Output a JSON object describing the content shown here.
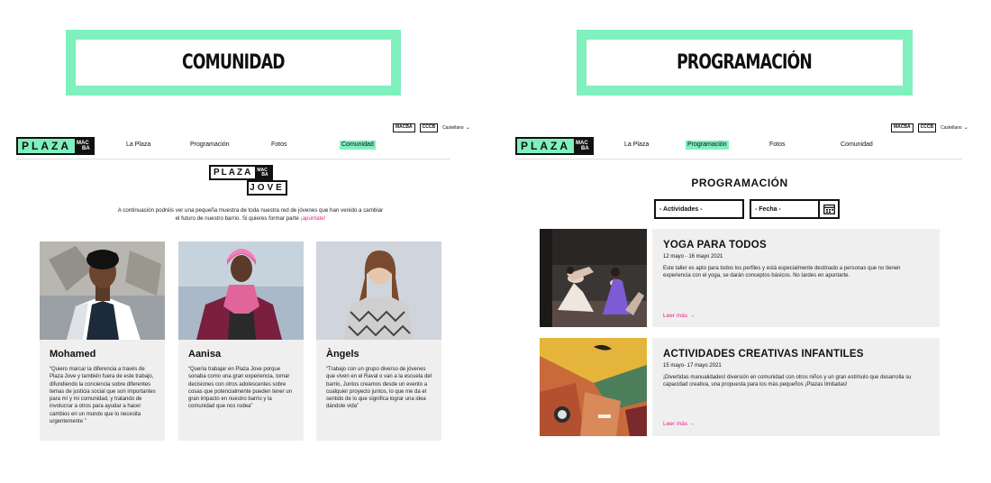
{
  "section_titles": {
    "left": "COMUNIDAD",
    "right": "PROGRAMACIÓN"
  },
  "util": {
    "badges": [
      "MACBA",
      "CCCB"
    ],
    "language": "Castellano"
  },
  "logo": {
    "plaza": "PLAZA",
    "mac": "MAC",
    "ba": "BA"
  },
  "nav": {
    "items": [
      "La Plaza",
      "Programación",
      "Fotos",
      "Comunidad"
    ],
    "active_left": "Comunidad",
    "active_right": "Programación"
  },
  "comunidad": {
    "jove_logo": {
      "plaza": "PLAZA",
      "mac": "MAC",
      "ba": "BA",
      "jove": "JOVE"
    },
    "intro_text": "A continuación podréis ver una pequeña muestra de toda nuestra red de jóvenes que han venido a cambiar el futuro de nuestro barrio. Si quieres formar parte ",
    "intro_link": "¡apúntate!",
    "cards": [
      {
        "name": "Mohamed",
        "quote": "“Quiero marcar la diferencia a través de Plaza Jove y también fuera de este trabajo, difundiendo la conciencia sobre diferentes temas de justicia social que son importantes para mí y mi comunidad, y tratando de involucrar a otros para ayudar a hacer cambios en un mundo que lo necesita urgentemente ”"
      },
      {
        "name": "Aanisa",
        "quote": "“Quería trabajar en Plaza Jove porque sonaba como una gran experiencia, tomar decisiones con otros adolescentes sobre cosas que potencialmente pueden tener un gran impacto en nuestro barrio y la comunidad que nos rodea”"
      },
      {
        "name": "Àngels",
        "quote": "“Trabajo con un grupo diverso de jóvenes que viven en el Raval o van a la escuela del barrio, Juntos creamos desde un evento a cualquier proyecto juntos, lo que me da el sentido de lo que significa lograr una idea dándole vida”"
      }
    ]
  },
  "programacion": {
    "heading": "PROGRAMACIÓN",
    "filters": {
      "actividades": "- Actividades -",
      "fecha": "- Fecha -"
    },
    "events": [
      {
        "title": "YOGA PARA TODOS",
        "date": "12 mayo - 16 mayo 2021",
        "description": "Este taller es apto para todos los perfiles y está especialmente destinado a personas que no tienen experiencia con el yoga, se darán conceptos básicos. No tardes en apuntarte.",
        "more": "Leer más →"
      },
      {
        "title": "ACTIVIDADES CREATIVAS INFANTILES",
        "date": "15 mayo- 17 mayo 2021",
        "description": "¡Divertidas manualidades! diversión en comunidad con otros niños y un gran estímulo que desarrolla su capacidad creativa, una propuesta para los más pequeños ¡Plazas limitadas!",
        "more": "Leer más →"
      }
    ]
  },
  "colors": {
    "accent": "#7ff0be",
    "link": "#e2268a",
    "card_bg": "#efefef"
  }
}
